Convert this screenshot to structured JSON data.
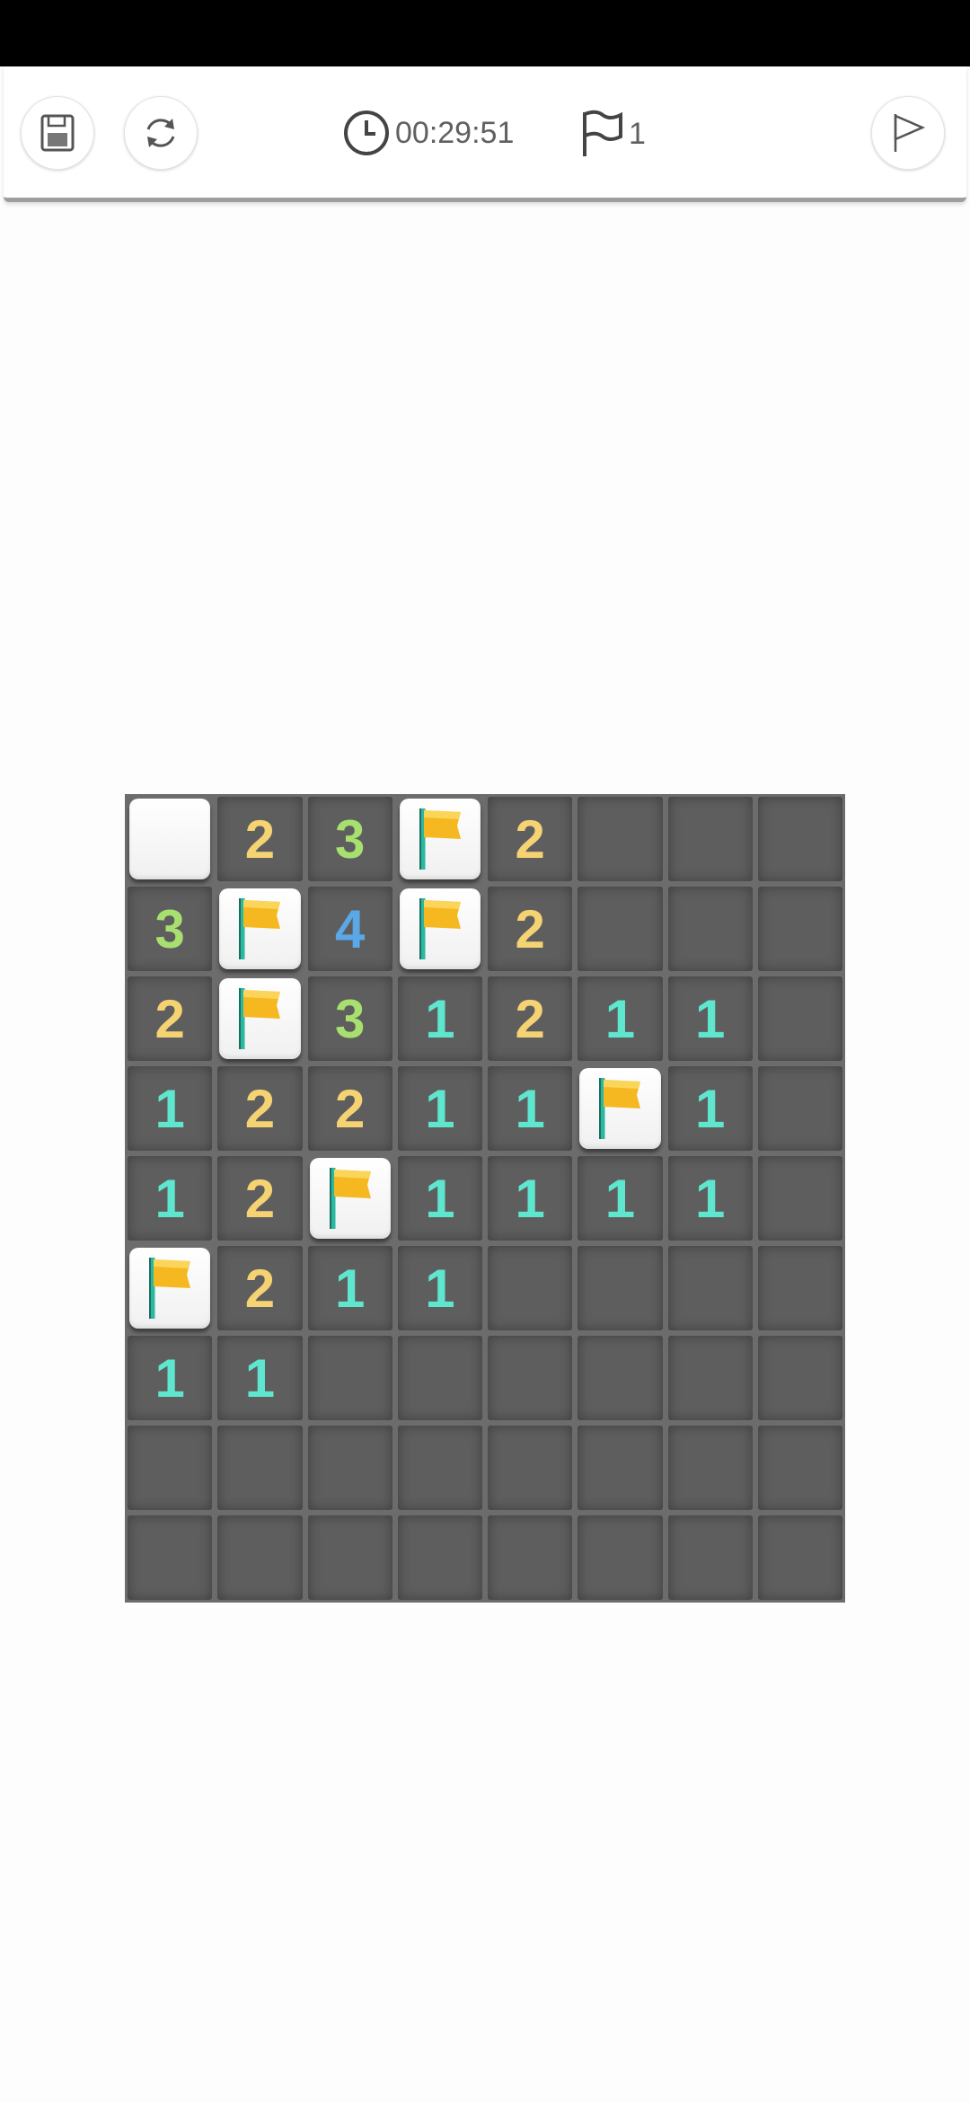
{
  "toolbar": {
    "save_icon": "save-icon",
    "restart_icon": "restart-icon",
    "timer_icon": "clock-icon",
    "timer": "00:29:51",
    "flag_counter_icon": "flag-outline-icon",
    "flag_count": "1",
    "flag_mode_icon": "flag-outline-icon"
  },
  "colors": {
    "number_1": "#5ee6cf",
    "number_2": "#f5d272",
    "number_3": "#a8e070",
    "number_4": "#5aa8e8",
    "flag": "#f5b820",
    "flag_pole": "#2bb8a0",
    "board": "#6c6c6c",
    "revealed_cell": "#5e5e5e",
    "covered_cell": "#ffffff"
  },
  "board": {
    "rows": 9,
    "cols": 8,
    "legend": "C = covered, F = flagged, 0 = empty revealed, 1-8 = number",
    "cells": [
      [
        "C",
        "2",
        "3",
        "F",
        "2",
        "0",
        "0",
        "0"
      ],
      [
        "3",
        "F",
        "4",
        "F",
        "2",
        "0",
        "0",
        "0"
      ],
      [
        "2",
        "F",
        "3",
        "1",
        "2",
        "1",
        "1",
        "0"
      ],
      [
        "1",
        "2",
        "2",
        "1",
        "1",
        "F",
        "1",
        "0"
      ],
      [
        "1",
        "2",
        "F",
        "1",
        "1",
        "1",
        "1",
        "0"
      ],
      [
        "F",
        "2",
        "1",
        "1",
        "0",
        "0",
        "0",
        "0"
      ],
      [
        "1",
        "1",
        "0",
        "0",
        "0",
        "0",
        "0",
        "0"
      ],
      [
        "0",
        "0",
        "0",
        "0",
        "0",
        "0",
        "0",
        "0"
      ],
      [
        "0",
        "0",
        "0",
        "0",
        "0",
        "0",
        "0",
        "0"
      ]
    ]
  }
}
